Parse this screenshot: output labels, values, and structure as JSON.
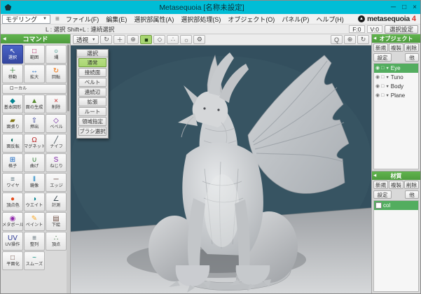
{
  "window": {
    "title": "Metasequoia [名称未設定]",
    "buttons": {
      "minimize": "─",
      "maximize": "□",
      "close": "×"
    }
  },
  "menu": {
    "mode_label": "モデリング",
    "mode_caret": "▼",
    "hamburger": "≡",
    "items": [
      "ファイル(F)",
      "編集(E)",
      "選択部属性(A)",
      "選択部処理(S)",
      "オブジェクト(O)",
      "パネル(P)",
      "ヘルプ(H)"
    ],
    "logo": {
      "name": "metasequoia",
      "version": "4"
    }
  },
  "toolbar": {
    "hint": "L : 選択  Shift+L : 連続選択",
    "faces": "F:0",
    "vertices": "V:0",
    "select_settings": "選択設定"
  },
  "command_panel": {
    "title": "コマンド",
    "collapse_icon": "◀",
    "tools": [
      {
        "label": "選択",
        "icon": "↖",
        "icon_color": "#222222",
        "selected": true
      },
      {
        "label": "範囲",
        "icon": "□",
        "icon_color": "#ad1457"
      },
      {
        "label": "縄",
        "icon": "○",
        "icon_color": "#00796b"
      },
      {
        "label": "移動",
        "icon": "＋",
        "icon_color": "#2e7d32"
      },
      {
        "label": "拡大",
        "icon": "↔",
        "icon_color": "#1565c0"
      },
      {
        "label": "回転",
        "icon": "↻",
        "icon_color": "#ef6c00"
      },
      {
        "label": "ローカル",
        "wide": true
      },
      {
        "label": "基本図形",
        "icon": "◆",
        "icon_color": "#00838f"
      },
      {
        "label": "面の生成",
        "icon": "▲",
        "icon_color": "#558b2f"
      },
      {
        "label": "削除",
        "icon": "×",
        "icon_color": "#c62828"
      },
      {
        "label": "面張り",
        "icon": "▰",
        "icon_color": "#827717"
      },
      {
        "label": "押出",
        "icon": "⇧",
        "icon_color": "#283593"
      },
      {
        "label": "ベベル",
        "icon": "◇",
        "icon_color": "#6a1b9a"
      },
      {
        "label": "面反転",
        "icon": "◐",
        "icon_color": "#00695c"
      },
      {
        "label": "マグネット",
        "icon": "Ω",
        "icon_color": "#b71c1c"
      },
      {
        "label": "ナイフ",
        "icon": "╱",
        "icon_color": "#37474f"
      },
      {
        "label": "格子",
        "icon": "⊞",
        "icon_color": "#1565c0"
      },
      {
        "label": "曲げ",
        "icon": "∪",
        "icon_color": "#2e7d32"
      },
      {
        "label": "ねじり",
        "icon": "S",
        "icon_color": "#7b1fa2"
      },
      {
        "label": "ワイヤ",
        "icon": "≡",
        "icon_color": "#546e7a"
      },
      {
        "label": "鏡像",
        "icon": "‖",
        "icon_color": "#0277bd"
      },
      {
        "label": "エッジ",
        "icon": "─",
        "icon_color": "#5d4037"
      },
      {
        "label": "頂点色",
        "icon": "●",
        "icon_color": "#e64a19"
      },
      {
        "label": "ウエイト",
        "icon": "◑",
        "icon_color": "#00838f"
      },
      {
        "label": "計測",
        "icon": "∠",
        "icon_color": "#37474f"
      },
      {
        "label": "メタボール",
        "icon": "◉",
        "icon_color": "#8e24aa"
      },
      {
        "label": "ペイント",
        "icon": "✎",
        "icon_color": "#f9a825"
      },
      {
        "label": "下絵",
        "icon": "▤",
        "icon_color": "#6d4c41"
      },
      {
        "label": "UV操作",
        "icon": "UV",
        "icon_color": "#283593"
      },
      {
        "label": "整列",
        "icon": "≡",
        "icon_color": "#455a64"
      },
      {
        "label": "頂点",
        "icon": "∴",
        "icon_color": "#1b5e20"
      },
      {
        "label": "平面化",
        "icon": "□",
        "icon_color": "#6d4c41"
      },
      {
        "label": "スムーズ",
        "icon": "~",
        "icon_color": "#00897b"
      }
    ]
  },
  "viewport": {
    "projection": "透視",
    "proj_caret": "▼",
    "icons_left": [
      {
        "name": "orbit-view-icon",
        "glyph": "↻"
      },
      {
        "name": "pan-view-icon",
        "glyph": "＋"
      },
      {
        "name": "zoom-view-icon",
        "glyph": "⊕"
      },
      {
        "name": "shading-mode-icon",
        "glyph": "■",
        "active": true
      },
      {
        "name": "wireframe-mode-icon",
        "glyph": "◇"
      },
      {
        "name": "vertex-display-icon",
        "glyph": "∴"
      },
      {
        "name": "light-icon",
        "glyph": "☼"
      },
      {
        "name": "settings-gear-icon",
        "glyph": "⚙"
      }
    ],
    "icons_right": [
      {
        "name": "magnify-icon",
        "glyph": "Q"
      },
      {
        "name": "fit-view-icon",
        "glyph": "⊕"
      },
      {
        "name": "reset-view-icon",
        "glyph": "↻"
      }
    ]
  },
  "select_panel": {
    "title": "選択",
    "modes": [
      {
        "label": "通常",
        "active": true
      },
      {
        "label": "接続面"
      },
      {
        "label": "ベルト"
      },
      {
        "label": "連続辺"
      },
      {
        "label": "拡張"
      },
      {
        "label": "ルート"
      },
      {
        "label": "領域指定"
      },
      {
        "label": "ブラシ選択"
      }
    ]
  },
  "object_panel": {
    "title": "オブジェクト",
    "collapse_icon": "◀",
    "buttons": [
      "新規",
      "複製",
      "削除"
    ],
    "settings_label": "設定",
    "other_label": "他",
    "items": [
      {
        "name": "Eye",
        "selected": true,
        "eye": "◉",
        "lock": "□",
        "caret": "▼"
      },
      {
        "name": "Tuno",
        "eye": "◉",
        "lock": "□",
        "caret": "▼"
      },
      {
        "name": "Body",
        "eye": "◉",
        "lock": "□",
        "caret": "▼"
      },
      {
        "name": "Plane",
        "eye": "◉",
        "lock": "□",
        "caret": "▼"
      }
    ]
  },
  "material_panel": {
    "title": "材質",
    "collapse_icon": "◀",
    "buttons": [
      "新規",
      "複製",
      "削除"
    ],
    "settings_label": "設定",
    "other_label": "他",
    "items": [
      {
        "name": "col",
        "selected": true,
        "swatch": "#ffffff"
      }
    ]
  },
  "colors": {
    "titlebar": "#00bdd6",
    "green": "#61b44e",
    "green_dark": "#4e9c3e",
    "blue": "#4a63c8",
    "blue_dark": "#35479f",
    "active_green": "#a8d671",
    "list_sel": "#53ad5f",
    "viewport_bg": "#334f5e",
    "logo_red": "#d93025"
  }
}
